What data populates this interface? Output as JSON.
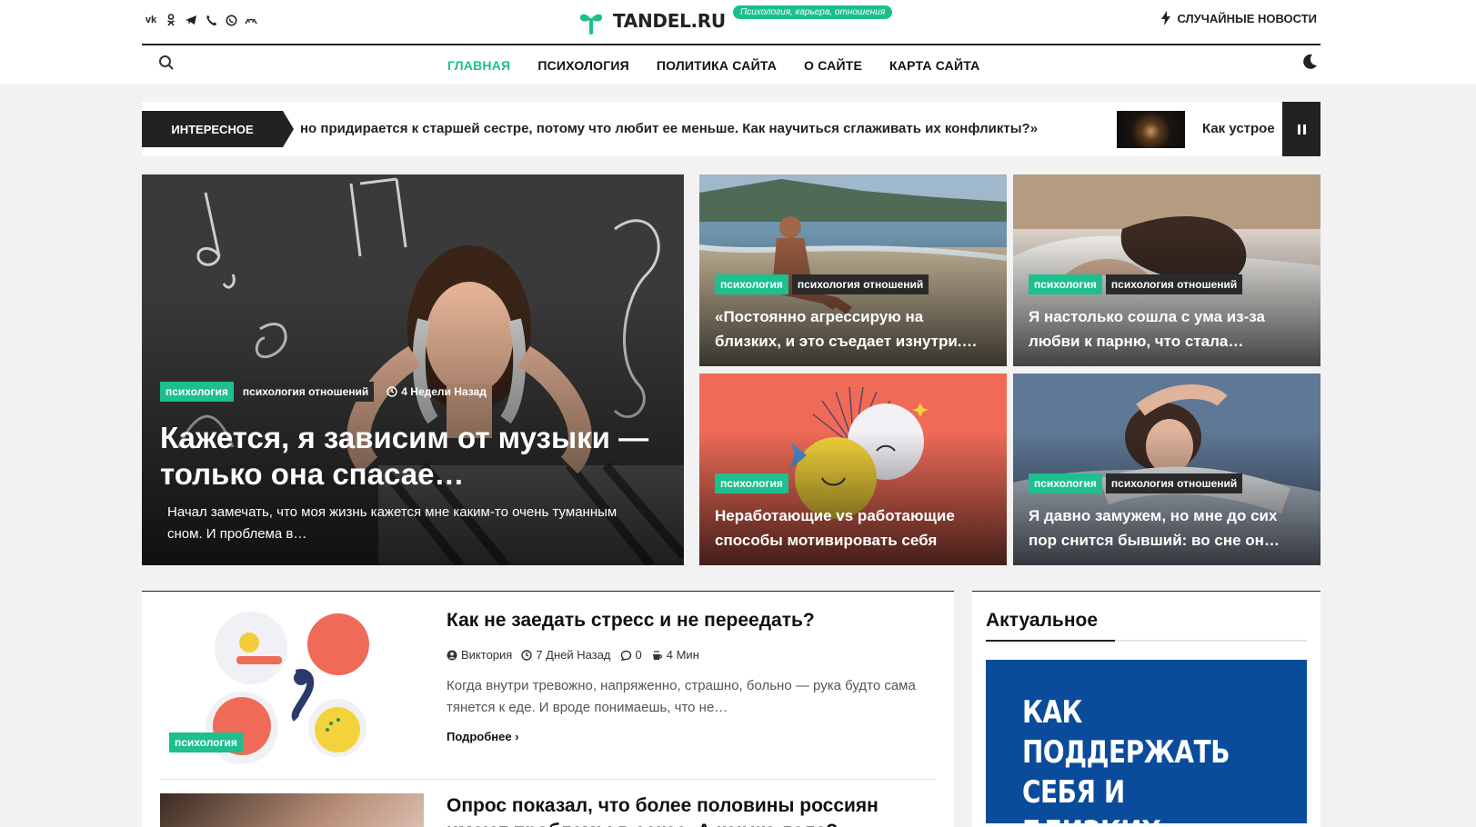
{
  "header": {
    "social_icons": [
      "vk-icon",
      "ok-icon",
      "telegram-icon",
      "viber-icon",
      "whatsapp-icon",
      "dzen-icon"
    ],
    "logo_text": "TANDEL.RU",
    "tagline": "Психология, карьера, отношения",
    "random_news": "СЛУЧАЙНЫЕ НОВОСТИ",
    "accent_color": "#1dbf8f"
  },
  "nav": {
    "items": [
      {
        "label": "ГЛАВНАЯ",
        "active": true
      },
      {
        "label": "ПСИХОЛОГИЯ",
        "active": false
      },
      {
        "label": "ПОЛИТИКА САЙТА",
        "active": false
      },
      {
        "label": "О САЙТЕ",
        "active": false
      },
      {
        "label": "КАРТА САЙТА",
        "active": false
      }
    ]
  },
  "ticker": {
    "label": "ИНТЕРЕСНОЕ",
    "text": "но придирается к старшей сестре, потому что любит ее меньше. Как научиться сглаживать их конфликты?»",
    "text2": "Как устрое"
  },
  "hero": {
    "tag1": "психология",
    "tag2": "психология отношений",
    "time": "4 Недели Назад",
    "title": "Кажется, я зависим от музыки — только она спасае…",
    "excerpt": "Начал замечать, что моя жизнь кажется мне каким-то очень туманным сном. И проблема в…"
  },
  "cards": [
    {
      "tag1": "психология",
      "tag2": "психология отношений",
      "title": "«Постоянно агрессирую на близких, и это съедает изнутри.…"
    },
    {
      "tag1": "психология",
      "tag2": "психология отношений",
      "title": "Я настолько сошла с ума из-за любви к парню, что стала…"
    },
    {
      "tag1": "психология",
      "tag2": "",
      "title": "Неработающие vs работающие способы мотивировать себя"
    },
    {
      "tag1": "психология",
      "tag2": "психология отношений",
      "title": "Я давно замужем, но мне до сих пор снится бывший: во сне он…"
    }
  ],
  "articles": [
    {
      "tag": "психология",
      "title": "Как не заедать стресс и не переедать?",
      "author": "Виктория",
      "time": "7 Дней Назад",
      "comments": "0",
      "read": "4 Мин",
      "excerpt": "Когда внутри тревожно, напряженно, страшно, больно — рука будто сама тянется к еде. И вроде понимаешь, что не…",
      "more": "Подробнее"
    },
    {
      "title": "Опрос показал, что более половины россиян имеют проблемы в сексе. А как же дела?"
    }
  ],
  "sidebar": {
    "title": "Актуальное",
    "banner_text": "КАК ПОДДЕРЖАТЬ СЕБЯ И БЛИЗКИХ"
  }
}
